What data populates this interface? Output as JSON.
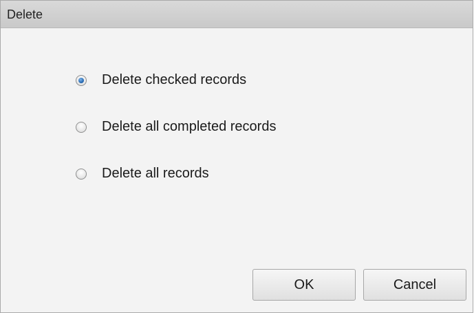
{
  "dialog": {
    "title": "Delete"
  },
  "options": [
    {
      "label": "Delete checked records",
      "selected": true
    },
    {
      "label": "Delete all completed records",
      "selected": false
    },
    {
      "label": "Delete all records",
      "selected": false
    }
  ],
  "buttons": {
    "ok_label": "OK",
    "cancel_label": "Cancel"
  },
  "colors": {
    "accent": "#2d6fb7",
    "dialog_background": "#f3f3f3",
    "titlebar_background": "#cfcfcf"
  }
}
